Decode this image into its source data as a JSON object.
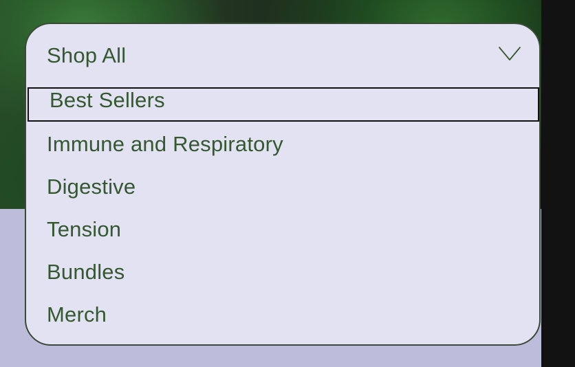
{
  "dropdown": {
    "selected_label": "Shop All",
    "items": [
      {
        "label": "Best Sellers",
        "focused": true
      },
      {
        "label": "Immune and Respiratory"
      },
      {
        "label": "Digestive"
      },
      {
        "label": "Tension"
      },
      {
        "label": "Bundles"
      },
      {
        "label": "Merch"
      }
    ]
  },
  "icons": {
    "toggle": "chevron-down-icon"
  },
  "colors": {
    "panel_bg": "#e2e2f2",
    "text": "#34582f",
    "border": "#3a4a35",
    "focus_ring": "#111111",
    "lower_band": "#bdbcda"
  }
}
